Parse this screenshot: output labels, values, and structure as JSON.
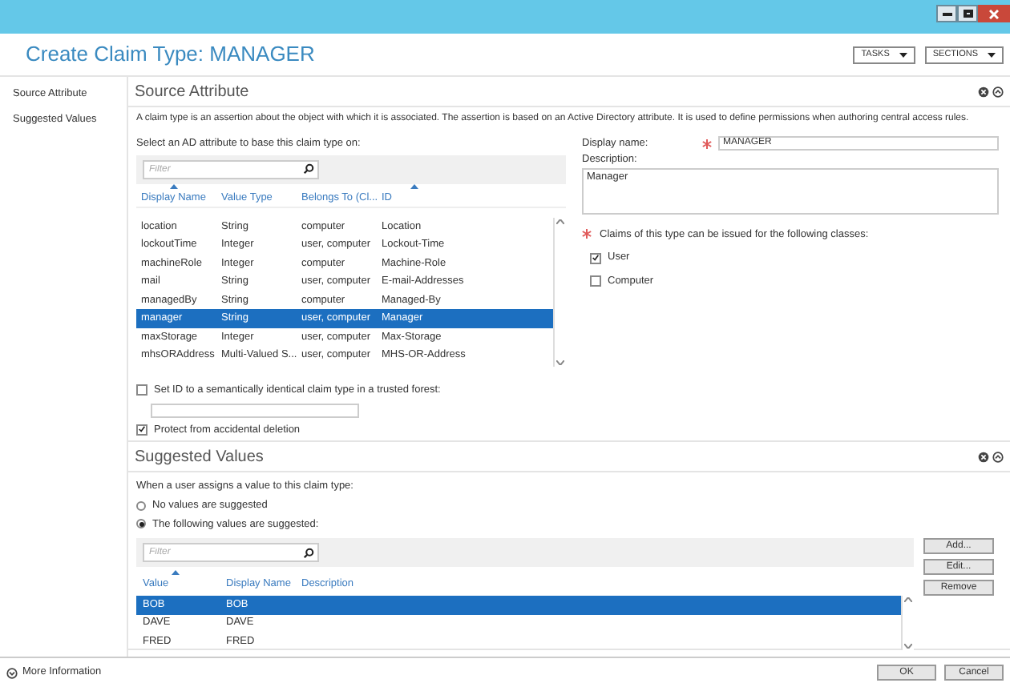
{
  "window": {
    "title": "Create Claim Type: MANAGER"
  },
  "header_buttons": [
    {
      "label": "TASKS"
    },
    {
      "label": "SECTIONS"
    }
  ],
  "nav": [
    {
      "label": "Source Attribute"
    },
    {
      "label": "Suggested Values"
    }
  ],
  "source_attribute": {
    "title": "Source Attribute",
    "description": "A claim type is an assertion about the object with which it is associated. The assertion is based on an Active Directory attribute. It is used to define permissions when authoring central access rules.",
    "select_label": "Select an AD attribute to base this claim type on:",
    "filter": {
      "placeholder": "Filter"
    },
    "columns": [
      {
        "label": "Display Name",
        "sorted": true
      },
      {
        "label": "Value Type",
        "sorted": false
      },
      {
        "label": "Belongs To (Cl...",
        "sorted": false
      },
      {
        "label": "ID",
        "sorted": true
      }
    ],
    "rows": [
      {
        "cells": [
          "location",
          "String",
          "computer",
          "Location"
        ],
        "selected": false
      },
      {
        "cells": [
          "lockoutTime",
          "Integer",
          "user, computer",
          "Lockout-Time"
        ],
        "selected": false
      },
      {
        "cells": [
          "machineRole",
          "Integer",
          "computer",
          "Machine-Role"
        ],
        "selected": false
      },
      {
        "cells": [
          "mail",
          "String",
          "user, computer",
          "E-mail-Addresses"
        ],
        "selected": false
      },
      {
        "cells": [
          "managedBy",
          "String",
          "computer",
          "Managed-By"
        ],
        "selected": false
      },
      {
        "cells": [
          "manager",
          "String",
          "user, computer",
          "Manager"
        ],
        "selected": true
      },
      {
        "cells": [
          "maxStorage",
          "Integer",
          "user, computer",
          "Max-Storage"
        ],
        "selected": false
      },
      {
        "cells": [
          "mhsORAddress",
          "Multi-Valued S...",
          "user, computer",
          "MHS-OR-Address"
        ],
        "selected": false
      }
    ],
    "display_name": {
      "label": "Display name:",
      "value": "MANAGER"
    },
    "description_field": {
      "label": "Description:",
      "value": "Manager"
    },
    "classes_label": "Claims of this type can be issued for the following classes:",
    "classes": [
      {
        "label": "User",
        "checked": true
      },
      {
        "label": "Computer",
        "checked": false
      }
    ],
    "set_id": {
      "label": "Set ID to a semantically identical claim type in a trusted forest:",
      "checked": false
    },
    "protect": {
      "label": "Protect from accidental deletion",
      "checked": true
    }
  },
  "suggested_values": {
    "title": "Suggested Values",
    "prompt": "When a user assigns a value to this claim type:",
    "options": [
      {
        "label": "No values are suggested",
        "selected": false
      },
      {
        "label": "The following values are suggested:",
        "selected": true
      }
    ],
    "filter": {
      "placeholder": "Filter"
    },
    "columns": [
      {
        "label": "Value",
        "sorted": true
      },
      {
        "label": "Display Name",
        "sorted": false
      },
      {
        "label": "Description",
        "sorted": false
      }
    ],
    "rows": [
      {
        "cells": [
          "BOB",
          "BOB"
        ],
        "selected": true
      },
      {
        "cells": [
          "DAVE",
          "DAVE"
        ],
        "selected": false
      },
      {
        "cells": [
          "FRED",
          "FRED"
        ],
        "selected": false
      }
    ],
    "buttons": [
      "Add...",
      "Edit...",
      "Remove"
    ]
  },
  "footer": {
    "more_info": "More Information",
    "buttons": [
      "OK",
      "Cancel"
    ]
  }
}
